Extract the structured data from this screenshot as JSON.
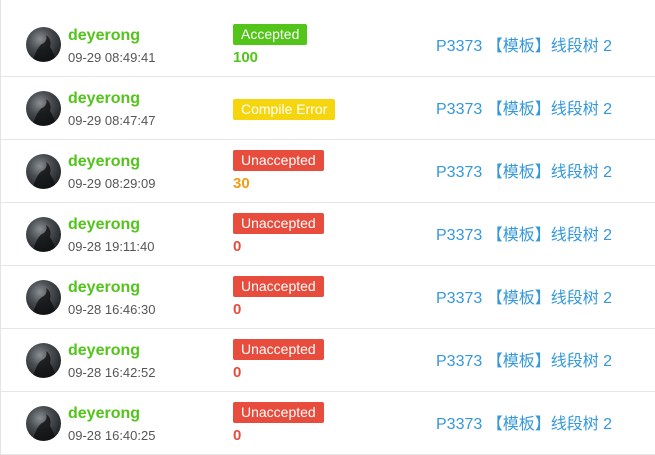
{
  "records": [
    {
      "user": "deyerong",
      "time": "09-29 08:49:41",
      "status": "Accepted",
      "status_color": "#52c41a",
      "score": "100",
      "score_color": "#52c41a",
      "problem": "P3373 【模板】线段树 2"
    },
    {
      "user": "deyerong",
      "time": "09-29 08:47:47",
      "status": "Compile Error",
      "status_color": "#f5d60e",
      "score": "",
      "score_color": "#e74c3c",
      "problem": "P3373 【模板】线段树 2"
    },
    {
      "user": "deyerong",
      "time": "09-29 08:29:09",
      "status": "Unaccepted",
      "status_color": "#e74c3c",
      "score": "30",
      "score_color": "#f39c12",
      "problem": "P3373 【模板】线段树 2"
    },
    {
      "user": "deyerong",
      "time": "09-28 19:11:40",
      "status": "Unaccepted",
      "status_color": "#e74c3c",
      "score": "0",
      "score_color": "#e74c3c",
      "problem": "P3373 【模板】线段树 2"
    },
    {
      "user": "deyerong",
      "time": "09-28 16:46:30",
      "status": "Unaccepted",
      "status_color": "#e74c3c",
      "score": "0",
      "score_color": "#e74c3c",
      "problem": "P3373 【模板】线段树 2"
    },
    {
      "user": "deyerong",
      "time": "09-28 16:42:52",
      "status": "Unaccepted",
      "status_color": "#e74c3c",
      "score": "0",
      "score_color": "#e74c3c",
      "problem": "P3373 【模板】线段树 2"
    },
    {
      "user": "deyerong",
      "time": "09-28 16:40:25",
      "status": "Unaccepted",
      "status_color": "#e74c3c",
      "score": "0",
      "score_color": "#e74c3c",
      "problem": "P3373 【模板】线段树 2"
    }
  ],
  "colors": {
    "user": "#52c41a",
    "problem_link": "#3498db"
  }
}
